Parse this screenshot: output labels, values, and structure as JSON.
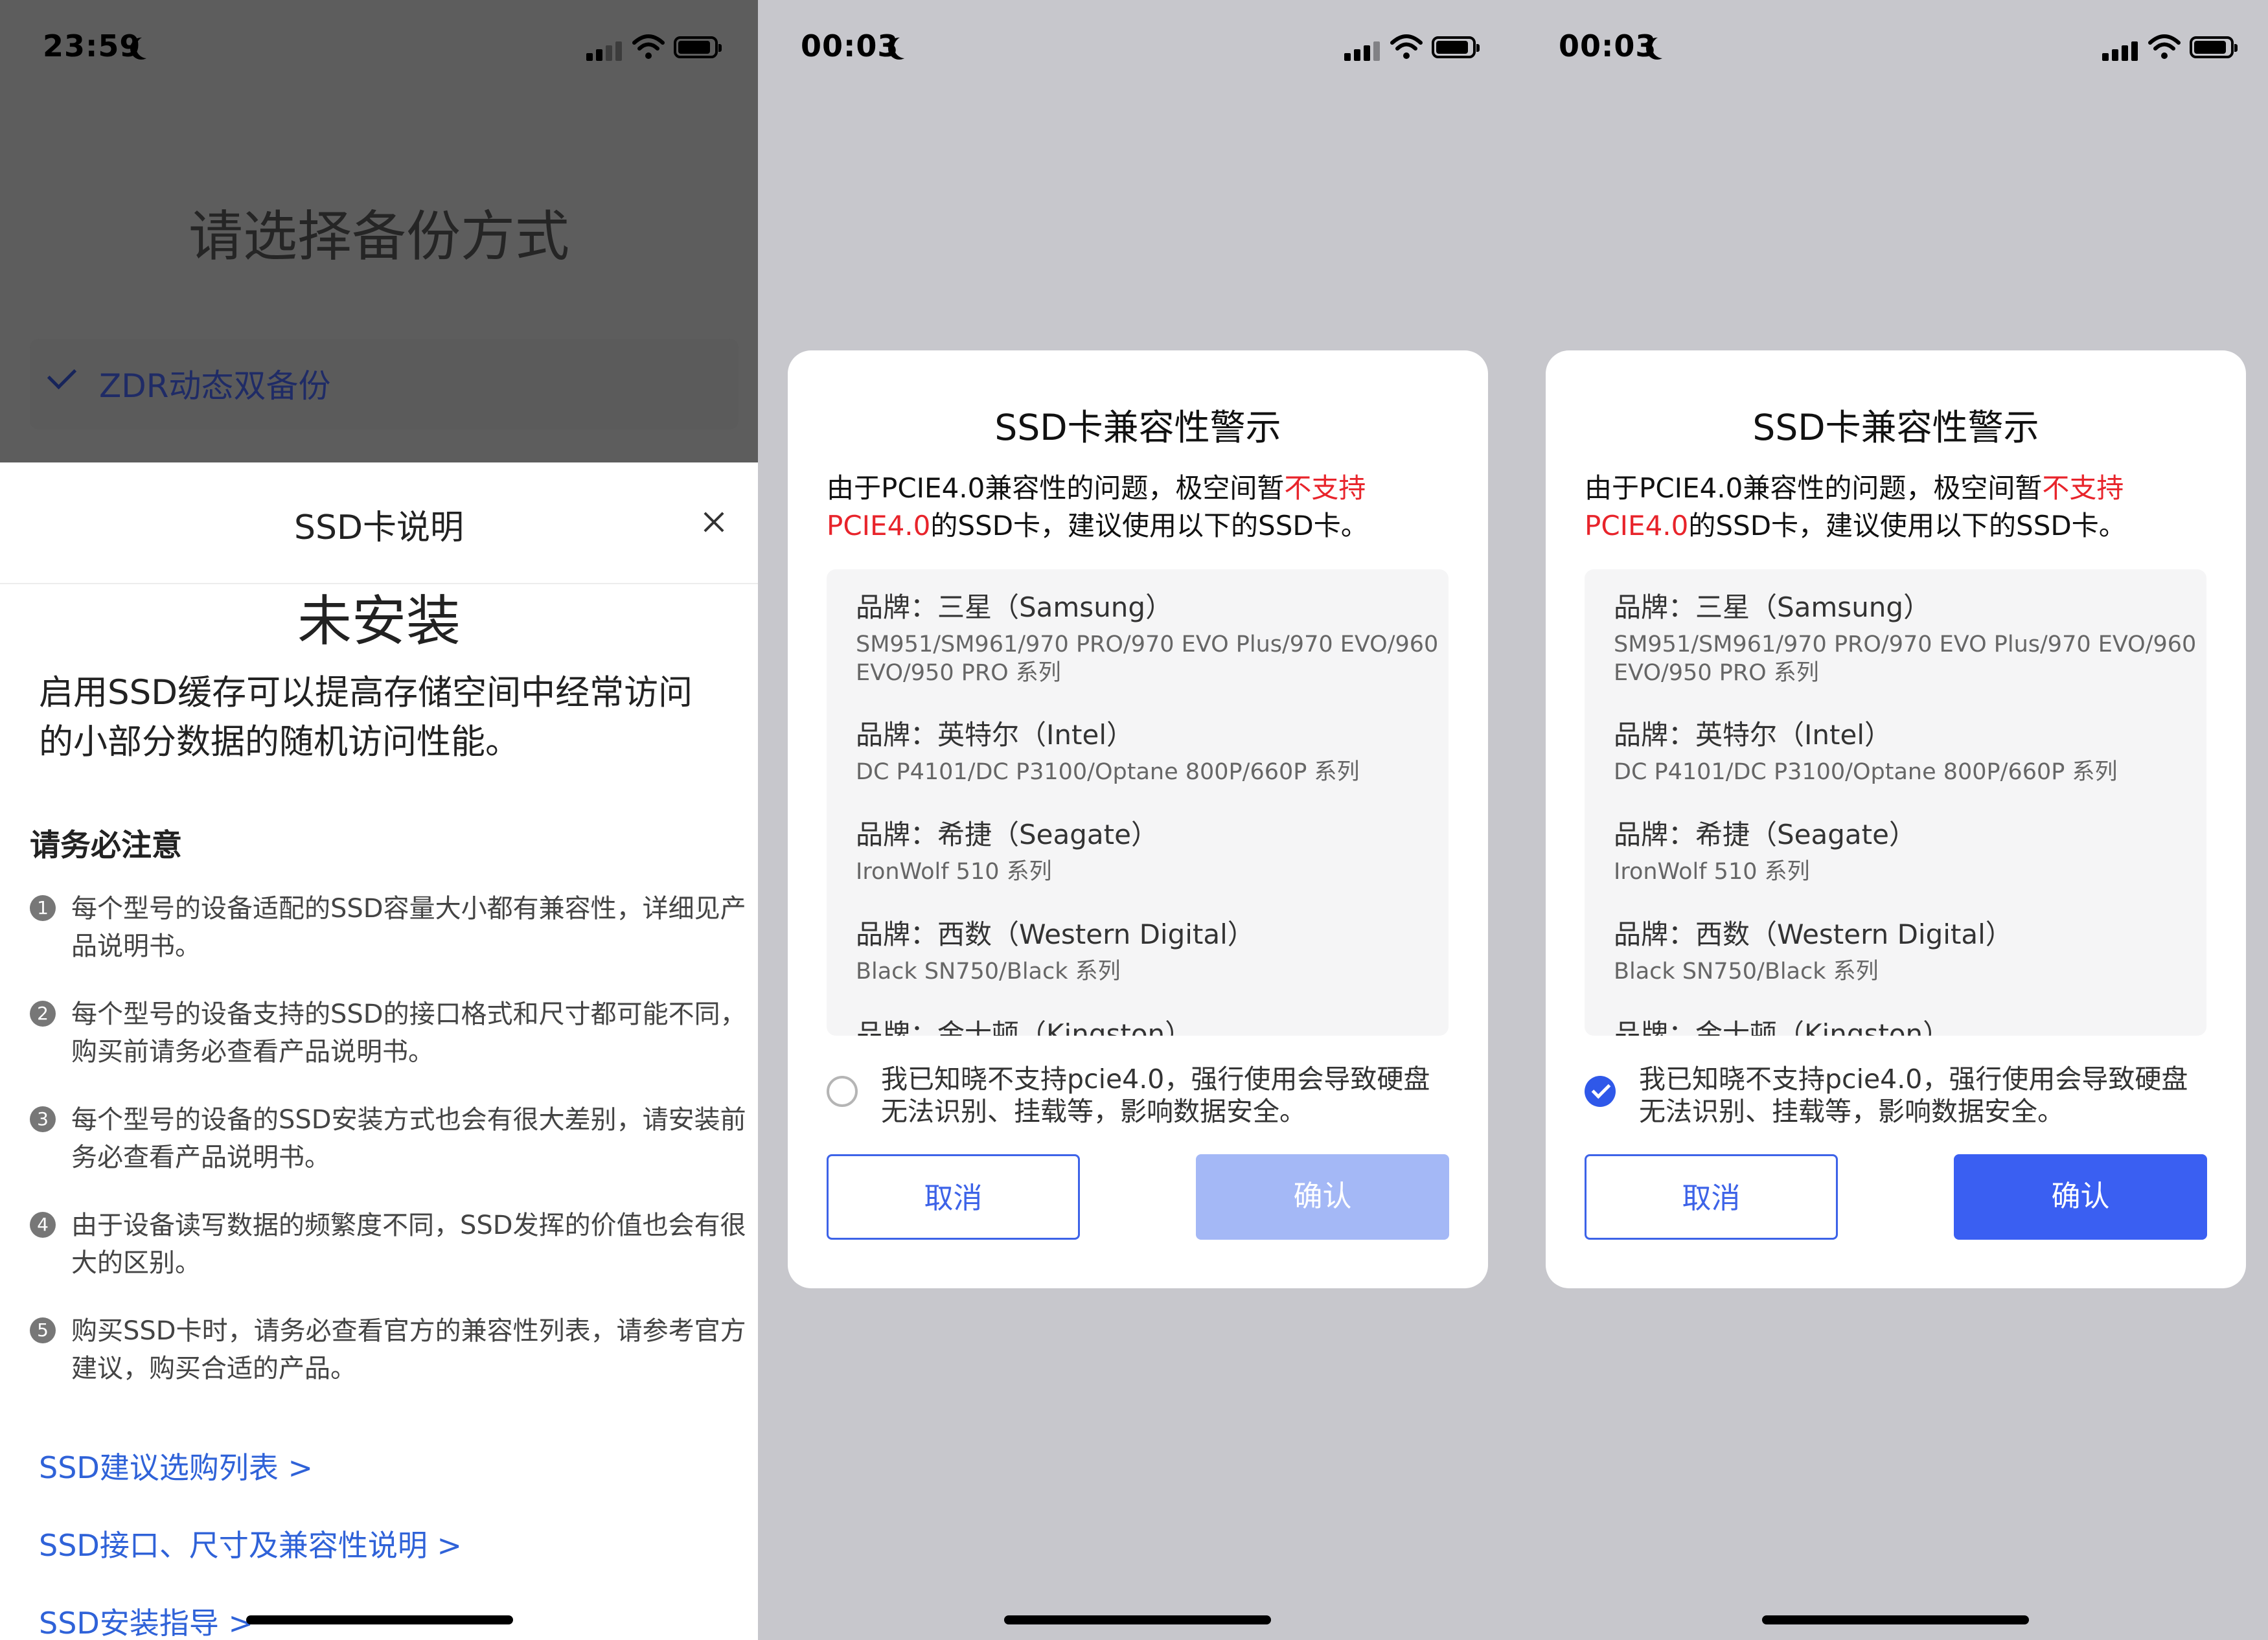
{
  "colors": {
    "accent": "#3A5FF2",
    "warning": "#E8242B",
    "link": "#2F62D8",
    "disabled_button": "#A4B8F6"
  },
  "screens": [
    {
      "status_bar": {
        "time": "23:59",
        "icons": [
          "moon-icon",
          "signal-icon",
          "wifi-icon",
          "battery-icon"
        ]
      },
      "background": {
        "title": "请选择备份方式",
        "option_label": "ZDR动态双备份"
      },
      "sheet": {
        "title": "SSD卡说明",
        "close_icon": "close-icon",
        "install_status": "未安装",
        "intro": "启用SSD缓存可以提高存储空间中经常访问的小部分数据的随机访问性能。",
        "notice_heading": "请务必注意",
        "notes": [
          {
            "num": "1",
            "text": "每个型号的设备适配的SSD容量大小都有兼容性，详细见产品说明书。"
          },
          {
            "num": "2",
            "text": "每个型号的设备支持的SSD的接口格式和尺寸都可能不同，购买前请务必查看产品说明书。"
          },
          {
            "num": "3",
            "text": "每个型号的设备的SSD安装方式也会有很大差别，请安装前务必查看产品说明书。"
          },
          {
            "num": "4",
            "text": "由于设备读写数据的频繁度不同，SSD发挥的价值也会有很大的区别。"
          },
          {
            "num": "5",
            "text": "购买SSD卡时，请务必查看官方的兼容性列表，请参考官方建议，购买合适的产品。"
          }
        ],
        "links": [
          "SSD建议选购列表 >",
          "SSD接口、尺寸及兼容性说明 >",
          "SSD安装指导 >"
        ]
      }
    },
    {
      "status_bar": {
        "time": "00:03",
        "icons": [
          "moon-icon",
          "signal-icon",
          "wifi-icon",
          "battery-icon"
        ]
      },
      "dialog": {
        "title": "SSD卡兼容性警示",
        "msg_part1": "由于PCIE4.0兼容性的问题，极空间暂",
        "msg_warn": "不支持PCIE4.0",
        "msg_part2": "的SSD卡，建议使用以下的SSD卡。",
        "brands": [
          {
            "name": "品牌：三星（Samsung）",
            "models": "SM951/SM961/970 PRO/970 EVO Plus/970 EVO/960 EVO/950 PRO 系列"
          },
          {
            "name": "品牌：英特尔（Intel）",
            "models": "DC P4101/DC P3100/Optane 800P/660P 系列"
          },
          {
            "name": "品牌：希捷（Seagate）",
            "models": "IronWolf 510 系列"
          },
          {
            "name": "品牌：西数（Western Digital）",
            "models": "Black SN750/Black 系列"
          },
          {
            "name": "品牌：金士顿（Kingston）",
            "models": ""
          }
        ],
        "ack_text": "我已知晓不支持pcie4.0，强行使用会导致硬盘无法识别、挂载等，影响数据安全。",
        "ack_checked": false,
        "cancel_label": "取消",
        "confirm_label": "确认",
        "confirm_enabled": false
      }
    },
    {
      "status_bar": {
        "time": "00:03",
        "icons": [
          "moon-icon",
          "signal-icon",
          "wifi-icon",
          "battery-icon"
        ]
      },
      "dialog": {
        "title": "SSD卡兼容性警示",
        "msg_part1": "由于PCIE4.0兼容性的问题，极空间暂",
        "msg_warn": "不支持PCIE4.0",
        "msg_part2": "的SSD卡，建议使用以下的SSD卡。",
        "brands": [
          {
            "name": "品牌：三星（Samsung）",
            "models": "SM951/SM961/970 PRO/970 EVO Plus/970 EVO/960 EVO/950 PRO 系列"
          },
          {
            "name": "品牌：英特尔（Intel）",
            "models": "DC P4101/DC P3100/Optane 800P/660P 系列"
          },
          {
            "name": "品牌：希捷（Seagate）",
            "models": "IronWolf 510 系列"
          },
          {
            "name": "品牌：西数（Western Digital）",
            "models": "Black SN750/Black 系列"
          },
          {
            "name": "品牌：金士顿（Kingston）",
            "models": ""
          }
        ],
        "ack_text": "我已知晓不支持pcie4.0，强行使用会导致硬盘无法识别、挂载等，影响数据安全。",
        "ack_checked": true,
        "cancel_label": "取消",
        "confirm_label": "确认",
        "confirm_enabled": true
      }
    }
  ]
}
